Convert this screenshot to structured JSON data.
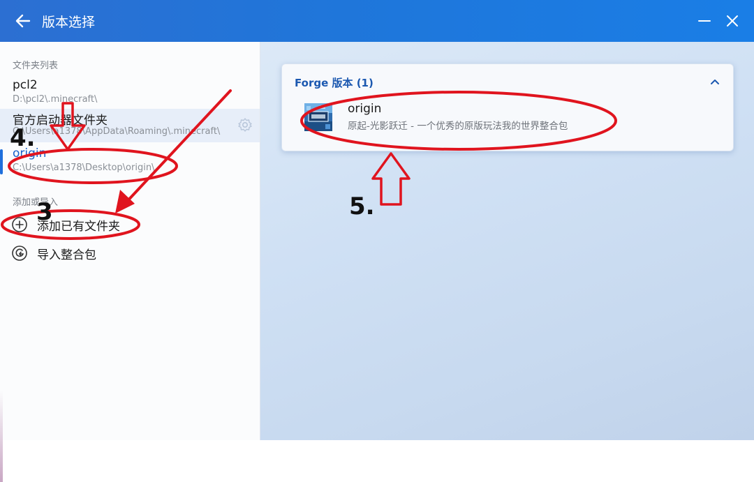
{
  "window": {
    "title": "版本选择",
    "back_icon": "arrow-left-icon",
    "minimize_icon": "minimize-icon",
    "close_icon": "close-icon"
  },
  "sidebar": {
    "folders_title": "文件夹列表",
    "folders": [
      {
        "name": "pcl2",
        "path": "D:\\pcl2\\.minecraft\\"
      },
      {
        "name": "官方启动器文件夹",
        "path": "C:\\Users\\a1378\\AppData\\Roaming\\.minecraft\\",
        "hovered": true
      },
      {
        "name": "origin",
        "path": "C:\\Users\\a1378\\Desktop\\origin\\",
        "selected": true
      }
    ],
    "add_title": "添加或导入",
    "actions": [
      {
        "label": "添加已有文件夹",
        "icon": "plus-circle-icon"
      },
      {
        "label": "导入整合包",
        "icon": "import-package-icon"
      }
    ]
  },
  "main": {
    "card": {
      "header": "Forge 版本 (1)",
      "collapse_icon": "chevron-up-icon",
      "items": [
        {
          "name": "origin",
          "description": "原起-光影跃迁 - 一个优秀的原版玩法我的世界整合包",
          "icon": "modpack-icon"
        }
      ]
    }
  },
  "annotations": {
    "label_3": "3",
    "label_4": "4.",
    "label_5": "5.",
    "color": "#e0141e"
  }
}
